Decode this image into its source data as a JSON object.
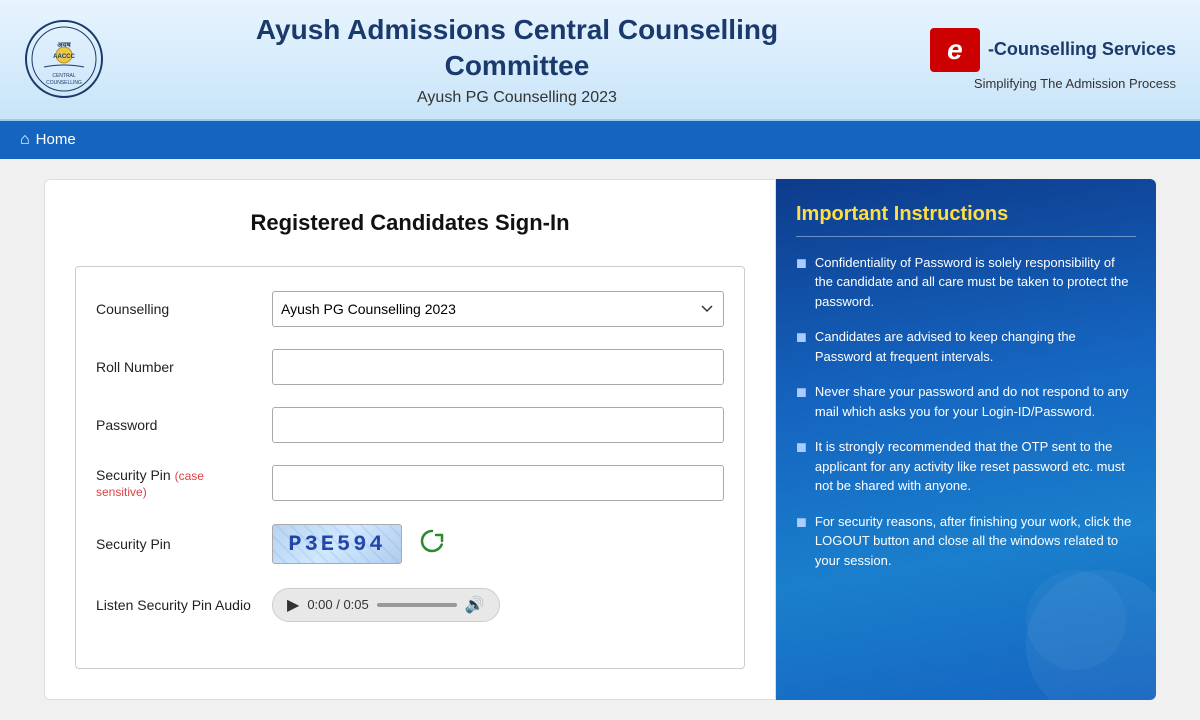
{
  "header": {
    "title_line1": "Ayush Admissions Central Counselling",
    "title_line2": "Committee",
    "subtitle": "Ayush PG Counselling 2023",
    "ecounselling_label": "e",
    "ecounselling_brand": "-Counselling Services",
    "ecounselling_tagline": "Simplifying The Admission Process"
  },
  "navbar": {
    "home_label": "Home"
  },
  "form": {
    "title": "Registered Candidates Sign-In",
    "counselling_label": "Counselling",
    "counselling_value": "Ayush PG Counselling 2023",
    "counselling_options": [
      "Ayush PG Counselling 2023"
    ],
    "roll_number_label": "Roll Number",
    "roll_number_placeholder": "",
    "password_label": "Password",
    "password_placeholder": "",
    "security_pin_input_label": "Security Pin",
    "security_pin_case_sensitive": "(case sensitive)",
    "security_pin_input_placeholder": "",
    "security_pin_captcha_label": "Security Pin",
    "captcha_text": "P3E594",
    "listen_label": "Listen Security Pin Audio",
    "audio_time": "0:00 / 0:05"
  },
  "instructions": {
    "title": "Important Instructions",
    "items": [
      "Confidentiality of Password is solely responsibility of the candidate and all care must be taken to protect the password.",
      "Candidates are advised to keep changing the Password at frequent intervals.",
      "Never share your password and do not respond to any mail which asks you for your Login-ID/Password.",
      "It is strongly recommended that the OTP sent to the applicant for any activity like reset password etc. must not be shared with anyone.",
      "For security reasons, after finishing your work, click the LOGOUT button and close all the windows related to your session."
    ]
  },
  "icons": {
    "home": "⌂",
    "dropdown_arrow": "▼",
    "refresh": "↻",
    "play": "▶",
    "volume": "🔊"
  }
}
